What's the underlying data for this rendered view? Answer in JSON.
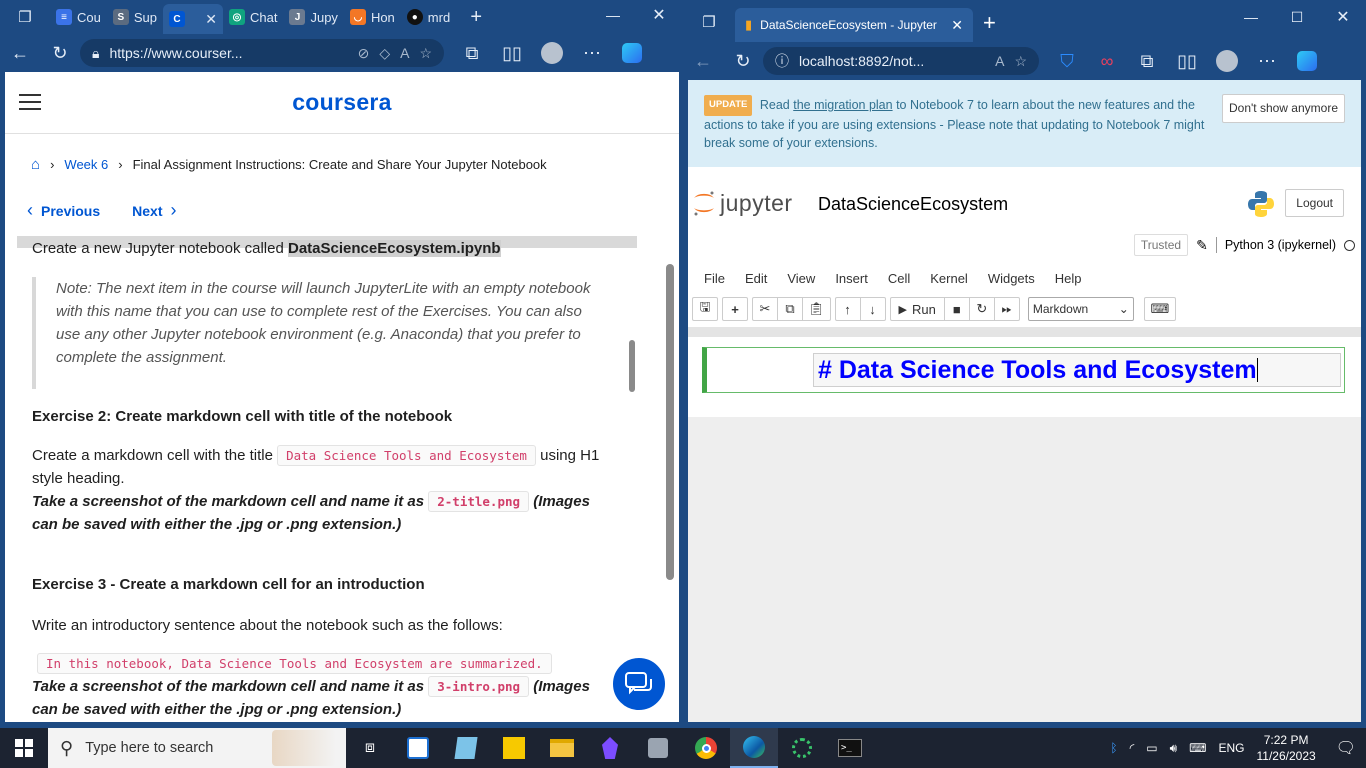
{
  "left_browser": {
    "tabs": [
      {
        "label": "Cou",
        "color": "#3b73e8",
        "glyph": "≡",
        "icon": "docs-icon"
      },
      {
        "label": "Sup",
        "color": "#5b6b80",
        "glyph": "S",
        "icon": "support-icon"
      },
      {
        "label": "",
        "color": "#0056d2",
        "glyph": "C",
        "icon": "coursera-icon",
        "active": true
      },
      {
        "label": "Chat",
        "color": "#10a37f",
        "glyph": "◎",
        "icon": "chatgpt-icon"
      },
      {
        "label": "Jupy",
        "color": "#6b7a90",
        "glyph": "J",
        "icon": "jupyter-tab-icon"
      },
      {
        "label": "Hon",
        "color": "#f37726",
        "glyph": "◡",
        "icon": "jupyter-home-icon"
      },
      {
        "label": "mrd",
        "color": "#111111",
        "glyph": "●",
        "icon": "github-icon"
      }
    ],
    "url": "https://www.courser...",
    "coursera": {
      "logo": "coursera",
      "breadcrumb": {
        "week": "Week 6",
        "page": "Final Assignment Instructions: Create and Share Your Jupyter Notebook"
      },
      "previous": "Previous",
      "next": "Next",
      "cut_line_prefix": "Create a new Jupyter notebook called",
      "cut_line_file": "DataScienceEcosystem.ipynb",
      "note": "Note: The next item in the course will launch JupyterLite with an empty notebook with this name that you can use to complete rest of the Exercises. You can also use any other Jupyter notebook environment (e.g. Anaconda) that you prefer to complete the assignment.",
      "ex2_title": "Exercise 2: Create markdown cell with title of the notebook",
      "ex2_text_a": "Create a markdown cell with the title",
      "ex2_code": "Data Science Tools and Ecosystem",
      "ex2_text_b": "using H1 style heading.",
      "ex2_shot_a": "Take a screenshot of the markdown cell and name it as",
      "ex2_png": "2-title.png",
      "ex2_shot_b": "(Images can be saved with either the .jpg or .png extension.)",
      "ex3_title": "Exercise 3 - Create a markdown cell for an introduction",
      "ex3_text": "Write an introductory sentence about the notebook such as the follows:",
      "ex3_code": "In this notebook, Data Science Tools and Ecosystem are summarized.",
      "ex3_shot_a": "Take a screenshot of the markdown cell and name it as",
      "ex3_png": "3-intro.png",
      "ex3_shot_b": "(Images can be saved with either the .jpg or .png extension.)"
    }
  },
  "right_browser": {
    "tab_title": "DataScienceEcosystem - Jupyter",
    "url": "localhost:8892/not...",
    "banner": {
      "badge": "UPDATE",
      "read": "Read",
      "link": "the migration plan",
      "text": "to Notebook 7 to learn about the new features and the actions to take if you are using extensions - Please note that updating to Notebook 7 might break some of your extensions.",
      "dismiss": "Don't show anymore"
    },
    "notebook": {
      "logo_text": "jupyter",
      "name": "DataScienceEcosystem",
      "logout": "Logout",
      "trusted": "Trusted",
      "kernel": "Python 3 (ipykernel)",
      "menu": [
        "File",
        "Edit",
        "View",
        "Insert",
        "Cell",
        "Kernel",
        "Widgets",
        "Help"
      ],
      "run_label": "Run",
      "cell_type": "Markdown",
      "cell_source": "# Data Science Tools and Ecosystem"
    }
  },
  "taskbar": {
    "search_placeholder": "Type here to search",
    "language": "ENG",
    "time": "7:22 PM",
    "date": "11/26/2023"
  },
  "colors": {
    "coursera_blue": "#0056d2",
    "jupyter_orange": "#f37726",
    "cell_green": "#42a546",
    "heading_blue": "#0000ff"
  }
}
